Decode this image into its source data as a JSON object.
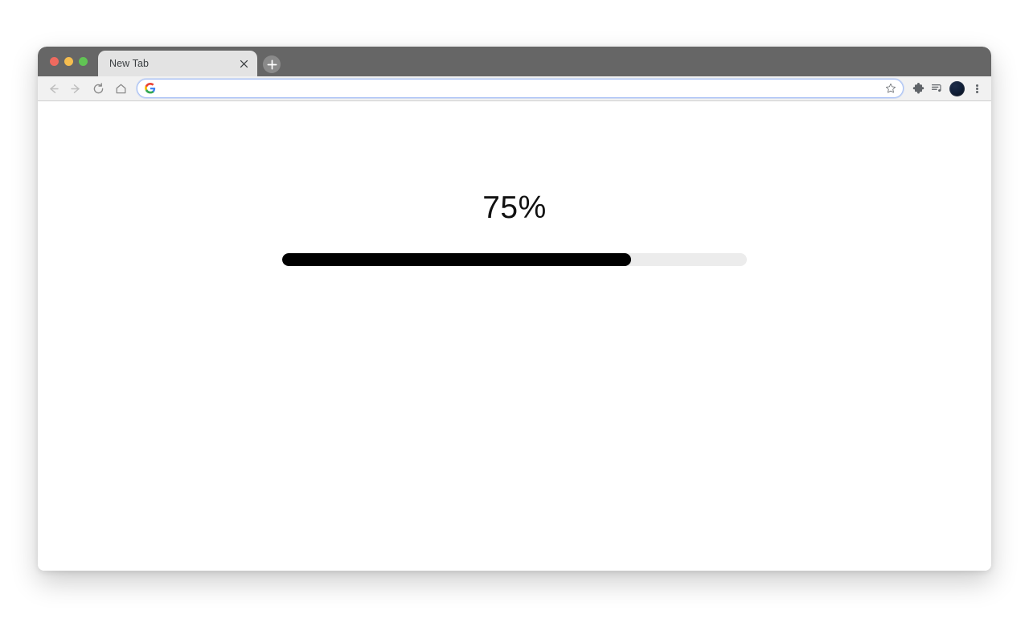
{
  "window": {
    "traffic_lights": [
      {
        "name": "close",
        "color": "#ee6a5f"
      },
      {
        "name": "minimize",
        "color": "#f5bd4f"
      },
      {
        "name": "maximize",
        "color": "#61c454"
      }
    ],
    "titlebar_color": "#666666"
  },
  "tabs": [
    {
      "label": "New Tab",
      "active": true,
      "close_icon": "close-icon"
    }
  ],
  "new_tab_button": {
    "icon": "plus-icon",
    "tooltip": "New Tab"
  },
  "toolbar": {
    "back": {
      "icon": "arrow-left-icon",
      "enabled": false
    },
    "forward": {
      "icon": "arrow-right-icon",
      "enabled": false
    },
    "reload": {
      "icon": "reload-icon"
    },
    "home": {
      "icon": "home-icon"
    },
    "omnibox": {
      "value": "",
      "placeholder": "",
      "leading_icon": "google-g-icon",
      "trailing_icon": "star-icon",
      "focused": true,
      "border_color": "#a9c1f5"
    },
    "extensions": {
      "icon": "puzzle-piece-icon"
    },
    "reading_list": {
      "icon": "reading-list-icon"
    },
    "profile": {
      "icon": "avatar-icon",
      "color": "#11203a"
    },
    "menu": {
      "icon": "three-dots-vertical-icon"
    }
  },
  "page": {
    "progress": {
      "percent_label": "75%",
      "value": 75,
      "min": 0,
      "max": 100,
      "fill_color": "#000000",
      "track_color": "#ececec"
    }
  }
}
